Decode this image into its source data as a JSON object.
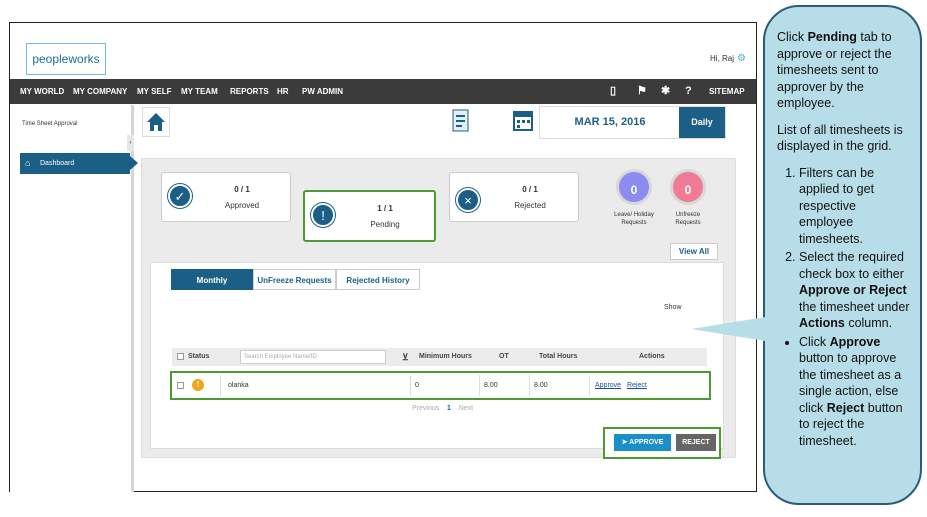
{
  "app": {
    "logo": "peopleworks",
    "greeting": "Hi, Raj"
  },
  "nav": {
    "items": [
      "MY WORLD",
      "MY COMPANY",
      "MY SELF",
      "MY TEAM",
      "REPORTS",
      "HR",
      "PW ADMIN"
    ],
    "sitemap": "SITEMAP"
  },
  "sidebar": {
    "title": "Time Sheet Approval",
    "dashboard": "Dashboard"
  },
  "header": {
    "date": "MAR 15, 2016",
    "view": "Daily"
  },
  "stats": {
    "approved": {
      "count": "0 / 1",
      "label": "Approved"
    },
    "pending": {
      "count": "1 / 1",
      "label": "Pending"
    },
    "rejected": {
      "count": "0 / 1",
      "label": "Rejected"
    },
    "leave": {
      "count": "0",
      "label1": "Leave/ Holiday",
      "label2": "Requests",
      "color": "#8b8bf0"
    },
    "unfreeze": {
      "count": "0",
      "label1": "Unfreeze",
      "label2": "Requests",
      "color": "#ef7b96"
    }
  },
  "view_all": "View All",
  "tabs": [
    "Monthly",
    "UnFreeze Requests",
    "Rejected History"
  ],
  "show_label": "Show",
  "table": {
    "columns": {
      "status": "Status",
      "search_placeholder": "Search Employee Name/ID",
      "min_hours": "Minimum Hours",
      "ot": "OT",
      "total_hours": "Total Hours",
      "actions": "Actions"
    },
    "rows": [
      {
        "name": "olanka",
        "min_hours": "0",
        "ot": "8.00",
        "total_hours": "8.00",
        "approve": "Approve",
        "reject": "Reject"
      }
    ]
  },
  "pager": {
    "prev": "Previous",
    "page": "1",
    "next": "Next"
  },
  "buttons": {
    "approve": "APPROVE",
    "reject": "REJECT"
  },
  "callout": {
    "p1_pre": "Click ",
    "p1_bold": "Pending",
    "p1_post": " tab to approve or reject the timesheets sent to approver by the employee.",
    "p2": "List of all timesheets is displayed in the grid.",
    "step1": "Filters can be applied to get respective employee timesheets.",
    "step2_pre": "Select the required check box to either ",
    "step2_b1": "Approve or Reject",
    "step2_mid": " the timesheet under ",
    "step2_b2": "Actions",
    "step2_post": " column.",
    "b1_pre": "Click ",
    "b1_bold": "Approve",
    "b1_mid": " button to approve the timesheet as a single action, else click ",
    "b1_bold2": "Reject",
    "b1_post": " button to reject the timesheet."
  }
}
